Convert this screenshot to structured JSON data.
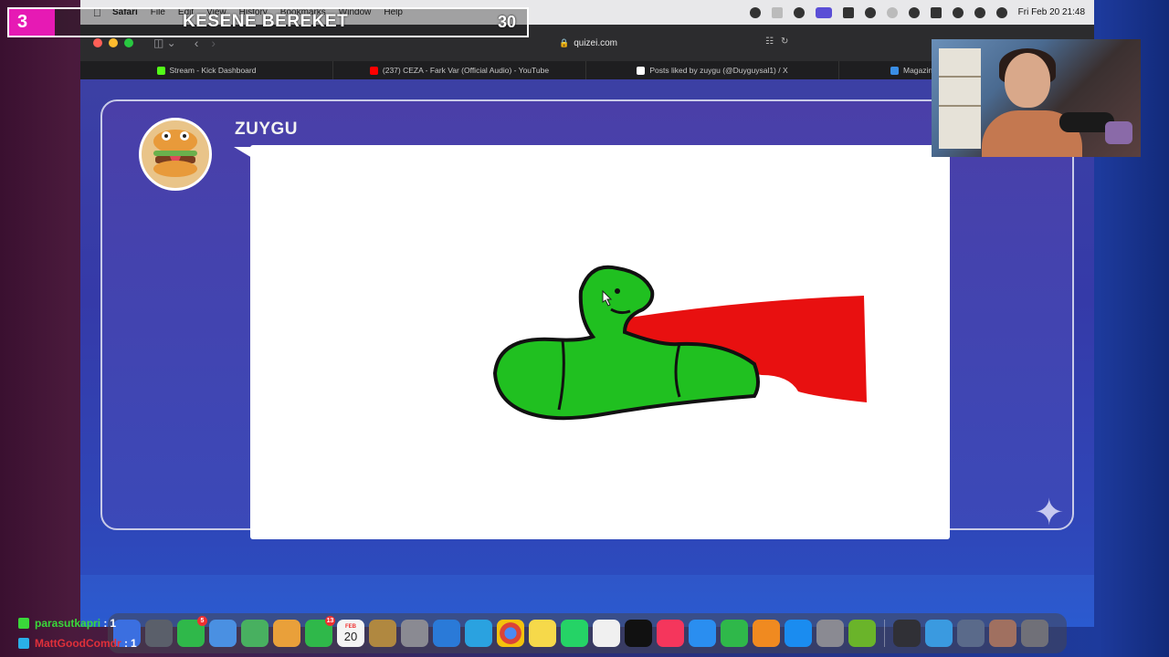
{
  "menubar": {
    "app_name": "Safari",
    "menus": [
      "File",
      "Edit",
      "View",
      "History",
      "Bookmarks",
      "Window",
      "Help"
    ],
    "clock": "Fri Feb 20  21:48"
  },
  "browser": {
    "url": "quizei.com",
    "tabs": [
      {
        "label": "Stream - Kick Dashboard",
        "favicon_color": "#53fc18"
      },
      {
        "label": "(237) CEZA - Fark Var (Official Audio) - YouTube",
        "favicon_color": "#ff0000"
      },
      {
        "label": "Posts liked by zuygu (@Duyguysal1) / X",
        "favicon_color": "#ffffff"
      },
      {
        "label": "Magazin",
        "favicon_color": "#3a8ee6"
      }
    ]
  },
  "game": {
    "player_name": "ZUYGU",
    "drawing_colors": {
      "body": "#20c020",
      "outline": "#111111",
      "cape": "#e81010"
    }
  },
  "stream_overlay": {
    "round": "3",
    "word": "KESENE BEREKET",
    "timer": "30"
  },
  "chat": [
    {
      "user": "parasutkapri",
      "count": "1",
      "color": "#3ad83a"
    },
    {
      "user": "MattGoodComdr",
      "count": "1",
      "color": "#e0303a"
    }
  ],
  "dock": {
    "calendar_date": "20",
    "calendar_month": "FEB",
    "badges": {
      "mail": "5",
      "messages": "13"
    }
  }
}
